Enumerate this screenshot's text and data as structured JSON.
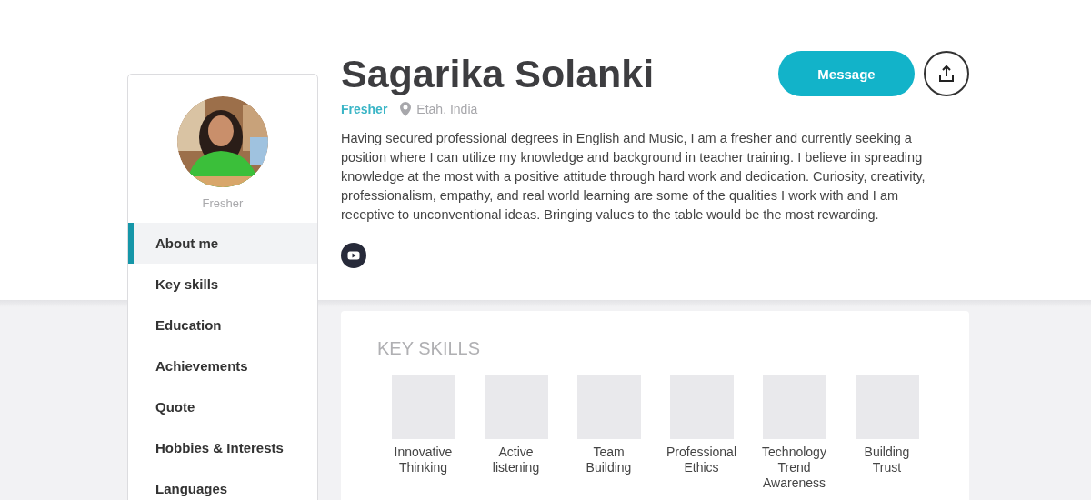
{
  "sidebar": {
    "caption": "Fresher",
    "items": [
      {
        "label": "About me",
        "selected": true
      },
      {
        "label": "Key skills",
        "selected": false
      },
      {
        "label": "Education",
        "selected": false
      },
      {
        "label": "Achievements",
        "selected": false
      },
      {
        "label": "Quote",
        "selected": false
      },
      {
        "label": "Hobbies & Interests",
        "selected": false
      },
      {
        "label": "Languages",
        "selected": false
      }
    ]
  },
  "profile": {
    "name": "Sagarika Solanki",
    "status": "Fresher",
    "location": "Etah, India",
    "about": "Having secured professional degrees in English and Music, I am a fresher and currently seeking a position where I can utilize my knowledge and background in teacher training. I believe in spreading knowledge at the most with a positive attitude through hard work and dedication. Curiosity, creativity, professionalism, empathy, and real world learning are some of the qualities I work with and I am receptive to unconventional ideas. Bringing values to the table would be the most rewarding.",
    "message_button": "Message"
  },
  "key_skills": {
    "title": "KEY SKILLS",
    "skills": [
      {
        "label": "Innovative Thinking"
      },
      {
        "label": "Active listening"
      },
      {
        "label": "Team Building"
      },
      {
        "label": "Professional Ethics"
      },
      {
        "label": "Technology Trend Awareness"
      },
      {
        "label": "Building Trust"
      }
    ]
  }
}
